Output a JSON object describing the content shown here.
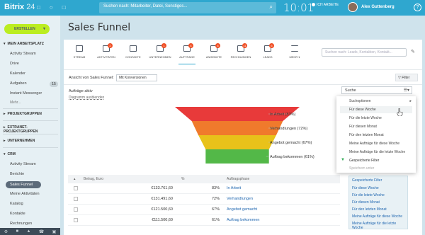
{
  "topbar": {
    "logo": "Bitrix",
    "logo_num": "24",
    "search_placeholder": "Suchen nach: Mitarbeiter, Datei, Sonstiges...",
    "clock": "10:01",
    "work_status": "ICH ARBEITE",
    "user_name": "Alex Guttenberg",
    "help": "?"
  },
  "sidebar": {
    "create_label": "ERSTELLEN",
    "my_workspace": "MEIN ARBEITSPLATZ",
    "items_top": [
      "Activity Stream",
      "Drive",
      "Kalender",
      "Aufgaben",
      "Instant Messenger"
    ],
    "tasks_count": "15",
    "more": "Mehr...",
    "groups": [
      "PROJEKTGRUPPEN",
      "EXTRANET-PROJEKTGRUPPEN",
      "UNTERNEHMEN",
      "CRM"
    ],
    "crm_items": [
      "Activity Stream",
      "Berichte",
      "Sales Funnel",
      "Meine Aktivitäten",
      "Katalog",
      "Kontakte",
      "Rechnungen"
    ]
  },
  "page": {
    "title": "Sales Funnel"
  },
  "toolbar": {
    "items": [
      {
        "label": "STREAM",
        "badge": ""
      },
      {
        "label": "AKTIVITÄTEN",
        "badge": "2"
      },
      {
        "label": "KONTAKTE",
        "badge": ""
      },
      {
        "label": "UNTERNEHMEN",
        "badge": "1"
      },
      {
        "label": "AUFTRÄGE",
        "badge": "4"
      },
      {
        "label": "ANGEBOTE",
        "badge": "6"
      },
      {
        "label": "RECHNUNGEN",
        "badge": "11"
      },
      {
        "label": "LEADS",
        "badge": "6"
      },
      {
        "label": "MEHR ▾",
        "badge": ""
      }
    ],
    "search_placeholder": "Suchen nach: Leads, Kontakten, Kontakt..."
  },
  "view": {
    "label": "Ansicht von Sales Funnel:",
    "select_value": "Mit Konversionen",
    "filter_label": "Filter",
    "section": "Aufträge aktiv",
    "toggle": "Diagramm ausblenden"
  },
  "chart_data": {
    "type": "funnel",
    "stages": [
      {
        "label": "In Arbeit (83%)",
        "value": 83,
        "color": "#e83a3a"
      },
      {
        "label": "Verhandlungen (72%)",
        "value": 72,
        "color": "#f07a2c"
      },
      {
        "label": "Angebot gemacht (67%)",
        "value": 67,
        "color": "#e8c21a"
      },
      {
        "label": "Auftrag bekommen (61%)",
        "value": 61,
        "color": "#53b848"
      }
    ]
  },
  "table": {
    "headers": [
      "Betrag, Euro",
      "%",
      "Auftragsphase"
    ],
    "rows": [
      {
        "amount": "€133.761,60",
        "pct": "83%",
        "phase": "In Arbeit"
      },
      {
        "amount": "€131.491,60",
        "pct": "72%",
        "phase": "Verhandlungen"
      },
      {
        "amount": "€121.500,60",
        "pct": "67%",
        "phase": "Angebot gemacht"
      },
      {
        "amount": "€111.500,60",
        "pct": "61%",
        "phase": "Auftrag bekommen"
      }
    ]
  },
  "filter_search": {
    "value": "Suche"
  },
  "dropdown": {
    "items": [
      {
        "label": "Suchoptionen",
        "arrow": "▸"
      },
      {
        "label": "Für diese Woche"
      },
      {
        "label": "Für die letzte Woche"
      },
      {
        "label": "Für diesen Monat"
      },
      {
        "label": "Für den letzten Monat"
      },
      {
        "label": "Meine Aufträge für diese Woche"
      },
      {
        "label": "Meine Aufträge für die letzte Woche"
      },
      {
        "label": "Gespeicherte Filter"
      },
      {
        "label": "Speichern unter"
      }
    ]
  },
  "saved_filters": {
    "title": "Gespeicherte Filter",
    "items": [
      "Für diese Woche",
      "Für die letzte Woche",
      "Für diesen Monat",
      "Für den letzten Monat",
      "Meine Aufträge für diese Woche",
      "Meine Aufträge für die letzte Woche"
    ]
  },
  "colors": {
    "accent": "#2fa7cf",
    "create": "#bbed21",
    "link": "#2067b0"
  }
}
